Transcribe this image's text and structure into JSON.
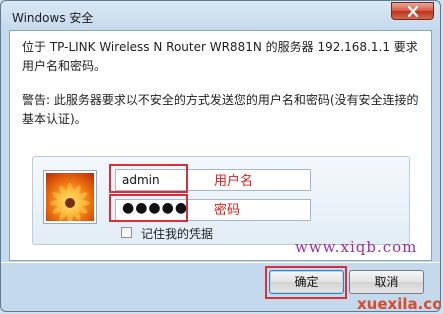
{
  "window": {
    "title": "Windows 安全",
    "close_icon": "close-icon"
  },
  "message": {
    "server_prompt": "位于 TP-LINK Wireless N Router WR881N 的服务器 192.168.1.1 要求用户名和密码。",
    "warning": "警告: 此服务器要求以不安全的方式发送您的用户名和密码(没有安全连接的基本认证)。"
  },
  "credentials": {
    "avatar_icon": "user-avatar-icon",
    "username_value": "admin",
    "password_value": "●●●●●",
    "remember_label": "记住我的凭据",
    "remember_checked": false
  },
  "annotations": {
    "username_label": "用户名",
    "password_label": "密码",
    "highlight_color": "#d6303a"
  },
  "watermarks": {
    "site1": "www.xiqb.com",
    "site2": "xuexila.com"
  },
  "buttons": {
    "ok_label": "确定",
    "cancel_label": "取消"
  }
}
